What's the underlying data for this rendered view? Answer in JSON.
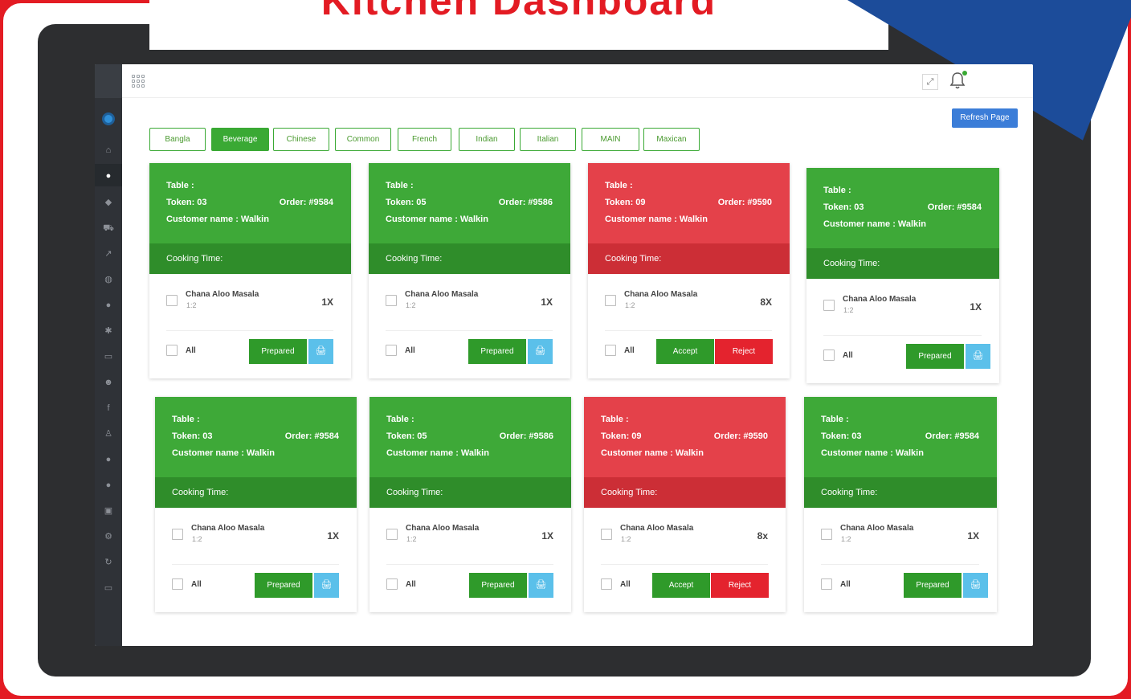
{
  "colors": {
    "brand_red": "#e31b23",
    "accent_blue": "#1c4c9a",
    "green": "#3ea938",
    "green_dark": "#2f8d2a",
    "red": "#e4414a",
    "red_dark": "#cc2e36",
    "print_blue": "#5bc0ea",
    "refresh_blue": "#3b7dd8"
  },
  "headline": "Kitchen Dashboard",
  "topbar": {
    "menu_icon": "grid-icon",
    "fullscreen_icon": "expand-icon",
    "notification_icon": "bell-icon"
  },
  "refresh_label": "Refresh Page",
  "categories": [
    {
      "label": "Bangla",
      "active": false
    },
    {
      "label": "Beverage",
      "active": true
    },
    {
      "label": "Chinese",
      "active": false
    },
    {
      "label": "Common",
      "active": false
    },
    {
      "label": "French",
      "active": false
    },
    {
      "label": "Indian",
      "active": false
    },
    {
      "label": "Italian",
      "active": false
    },
    {
      "label": "MAIN",
      "active": false
    },
    {
      "label": "Maxican",
      "active": false
    }
  ],
  "sidebar_icons": [
    "logo-icon",
    "home-icon",
    "dashboard-icon",
    "tag-icon",
    "cart-icon",
    "chart-icon",
    "globe-icon",
    "circle-icon",
    "settings-icon",
    "calendar-icon",
    "users-icon",
    "facebook-icon",
    "user-icon",
    "circle-icon",
    "circle-icon",
    "lock-icon",
    "gear-icon",
    "refresh-icon",
    "monitor-icon"
  ],
  "cards": [
    {
      "status": "green",
      "table": "Table :",
      "token": "Token: 03",
      "order": "Order: #9584",
      "customer": "Customer name : Walkin",
      "cooking": "Cooking Time:",
      "item_name": "Chana Aloo Masala",
      "item_sub": "1:2",
      "qty": "1X",
      "all": "All",
      "btn1": "Prepared",
      "btn2": "🖨"
    },
    {
      "status": "green",
      "table": "Table :",
      "token": "Token: 05",
      "order": "Order: #9586",
      "customer": "Customer name : Walkin",
      "cooking": "Cooking Time:",
      "item_name": "Chana Aloo Masala",
      "item_sub": "1:2",
      "qty": "1X",
      "all": "All",
      "btn1": "Prepared",
      "btn2": "🖨"
    },
    {
      "status": "red",
      "table": "Table :",
      "token": "Token: 09",
      "order": "Order: #9590",
      "customer": "Customer name : Walkin",
      "cooking": "Cooking Time:",
      "item_name": "Chana Aloo Masala",
      "item_sub": "1:2",
      "qty": "8X",
      "all": "All",
      "btn1": "Accept",
      "btn2": "Reject"
    },
    {
      "status": "green",
      "table": "Table :",
      "token": "Token: 03",
      "order": "Order: #9584",
      "customer": "Customer name : Walkin",
      "cooking": "Cooking Time:",
      "item_name": "Chana Aloo Masala",
      "item_sub": "1:2",
      "qty": "1X",
      "all": "All",
      "btn1": "Prepared",
      "btn2": "🖨"
    },
    {
      "status": "green",
      "table": "Table :",
      "token": "Token: 03",
      "order": "Order: #9584",
      "customer": "Customer name : Walkin",
      "cooking": "Cooking Time:",
      "item_name": "Chana Aloo Masala",
      "item_sub": "1:2",
      "qty": "1X",
      "all": "All",
      "btn1": "Prepared",
      "btn2": "🖨"
    },
    {
      "status": "green",
      "table": "Table :",
      "token": "Token: 05",
      "order": "Order: #9586",
      "customer": "Customer name : Walkin",
      "cooking": "Cooking Time:",
      "item_name": "Chana Aloo Masala",
      "item_sub": "1:2",
      "qty": "1X",
      "all": "All",
      "btn1": "Prepared",
      "btn2": "🖨"
    },
    {
      "status": "red",
      "table": "Table :",
      "token": "Token: 09",
      "order": "Order: #9590",
      "customer": "Customer name : Walkin",
      "cooking": "Cooking Time:",
      "item_name": "Chana Aloo Masala",
      "item_sub": "1:2",
      "qty": "8x",
      "all": "All",
      "btn1": "Accept",
      "btn2": "Reject"
    },
    {
      "status": "green",
      "table": "Table :",
      "token": "Token: 03",
      "order": "Order: #9584",
      "customer": "Customer name : Walkin",
      "cooking": "Cooking Time:",
      "item_name": "Chana Aloo Masala",
      "item_sub": "1:2",
      "qty": "1X",
      "all": "All",
      "btn1": "Prepared",
      "btn2": "🖨"
    }
  ]
}
